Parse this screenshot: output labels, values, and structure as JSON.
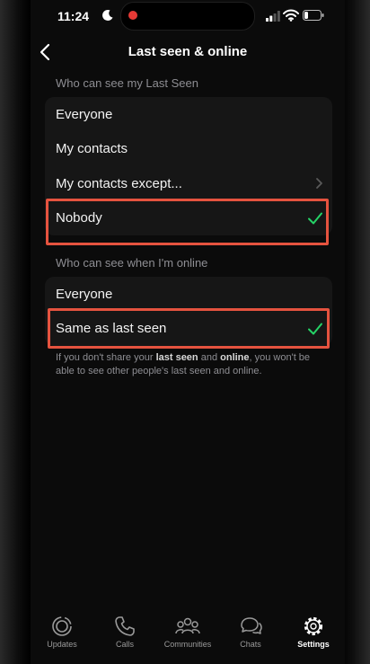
{
  "status_bar": {
    "time": "11:24"
  },
  "nav": {
    "title": "Last seen & online"
  },
  "last_seen": {
    "header": "Who can see my Last Seen",
    "options": [
      "Everyone",
      "My contacts",
      "My contacts except...",
      "Nobody"
    ],
    "selected": "Nobody"
  },
  "online": {
    "header": "Who can see when I'm online",
    "options": [
      "Everyone",
      "Same as last seen"
    ],
    "selected": "Same as last seen"
  },
  "footnote": {
    "part1": "If you don't share your ",
    "bold1": "last seen",
    "part2": " and ",
    "bold2": "online",
    "part3": ", you won't be able to see other people's last seen and online."
  },
  "tabs": [
    "Updates",
    "Calls",
    "Communities",
    "Chats",
    "Settings"
  ],
  "active_tab": "Settings",
  "colors": {
    "accent": "#25d366",
    "highlight": "#e5533f"
  }
}
